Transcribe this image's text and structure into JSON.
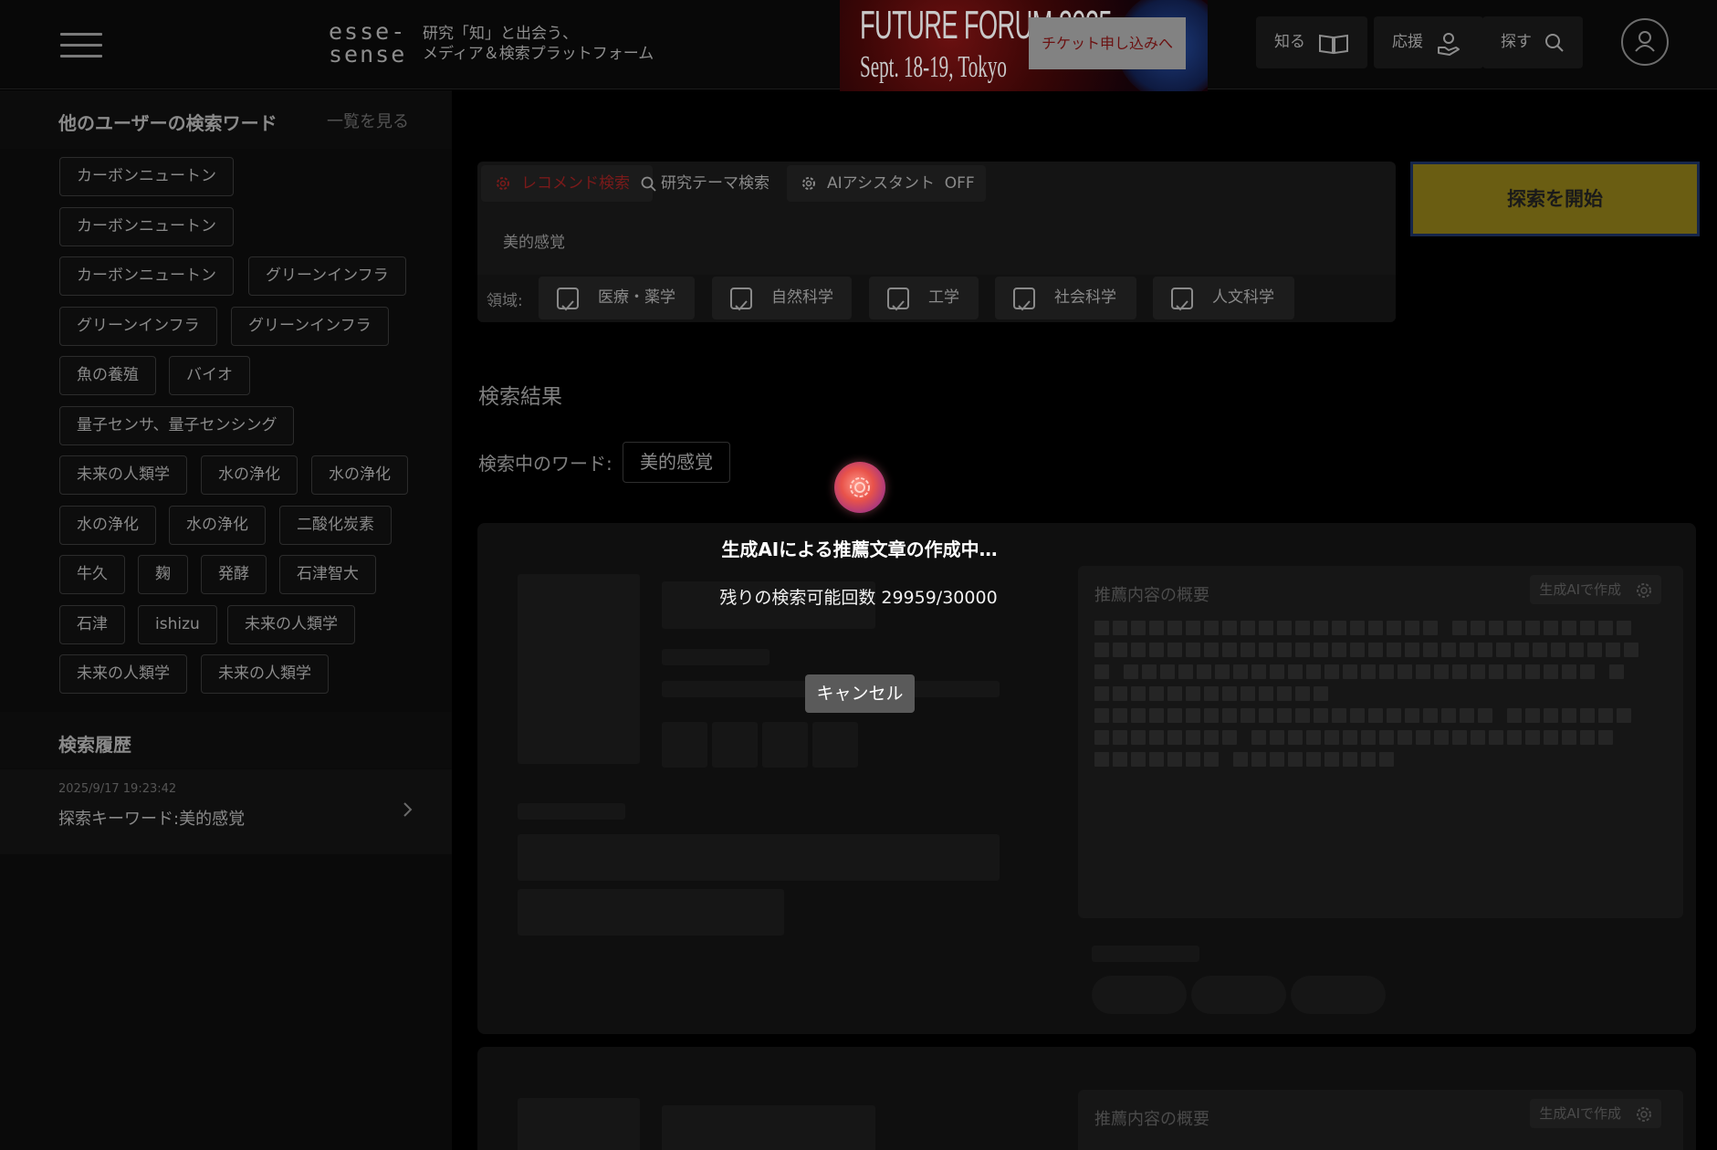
{
  "header": {
    "logo_line1": "esse-",
    "logo_line2": "sense",
    "tagline_line1": "研究「知」と出会う、",
    "tagline_line2": "メディア＆検索プラットフォーム",
    "banner_title": "FUTURE FORUM 2025",
    "banner_date": "Sept. 18-19, Tokyo",
    "ticket_label": "チケット申し込みへ",
    "nav": [
      {
        "label": "知る",
        "icon": "book-icon"
      },
      {
        "label": "応援",
        "icon": "hand-heart-icon"
      },
      {
        "label": "探す",
        "icon": "search-icon"
      }
    ],
    "account_icon": "user-icon"
  },
  "sidebar": {
    "title": "他のユーザーの検索ワード",
    "see_all": "一覧を見る",
    "tags": [
      "カーボンニュートン",
      "カーボンニュートン",
      "カーボンニュートン",
      "グリーンインフラ",
      "グリーンインフラ",
      "グリーンインフラ",
      "魚の養殖",
      "バイオ",
      "量子センサ、量子センシング",
      "未来の人類学",
      "水の浄化",
      "水の浄化",
      "水の浄化",
      "水の浄化",
      "二酸化炭素",
      "牛久",
      "麹",
      "発酵",
      "石津智大",
      "石津",
      "ishizu",
      "未来の人類学",
      "未来の人類学",
      "未来の人類学"
    ],
    "history_title": "検索履歴",
    "history": [
      {
        "date": "2025/9/17 19:23:42",
        "text": "探索キーワード:美的感覚"
      }
    ]
  },
  "search": {
    "tabs": [
      {
        "label": "レコメンド検索",
        "icon": "gear-icon",
        "active": true
      },
      {
        "label": "研究テーマ検索",
        "icon": "search-icon",
        "active": false
      },
      {
        "label": "AIアシスタント  OFF",
        "icon": "gear-icon",
        "active": false
      }
    ],
    "query": "美的感覚",
    "domain_label": "領域:",
    "domains": [
      "医療・薬学",
      "自然科学",
      "工学",
      "社会科学",
      "人文科学"
    ],
    "start_label": "探索を開始"
  },
  "results": {
    "title": "検索結果",
    "searching_label": "検索中のワード:",
    "searching_word": "美的感覚",
    "summary_title": "推薦内容の概要",
    "generate_label": "生成AIで作成"
  },
  "overlay": {
    "message": "生成AIによる推薦文章の作成中…",
    "remaining": "残りの検索可能回数 29959/30000",
    "cancel_label": "キャンセル"
  },
  "colors": {
    "accent_red": "#b02020",
    "start_button": "#6a5d12",
    "background": "#000000"
  }
}
